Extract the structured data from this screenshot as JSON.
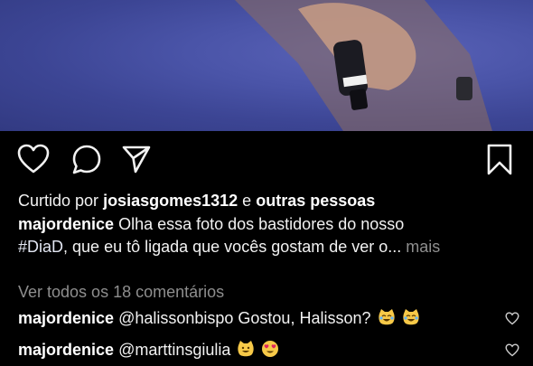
{
  "post": {
    "likes": {
      "prefix": "Curtido por",
      "user": "josiasgomes1312",
      "connector": "e",
      "others": "outras pessoas"
    },
    "caption": {
      "username": "majordenice",
      "text": "Olha essa foto dos bastidores do nosso",
      "hashtag": "#DiaD",
      "text2": ", que eu tô ligada que vocês gostam de ver o...",
      "more_label": "mais"
    },
    "view_comments_label": "Ver todos os 18 comentários",
    "comments": [
      {
        "username": "majordenice",
        "text": "@halissonbispo Gostou, Halisson?",
        "emojis": [
          "joy-cat-emoji",
          "joy-cat-emoji"
        ]
      },
      {
        "username": "majordenice",
        "text": "@marttinsgiulia",
        "emojis": [
          "smiley-cat-emoji",
          "heart-eyes-emoji"
        ]
      }
    ]
  },
  "icons": {
    "like": "heart-icon",
    "comment": "comment-bubble-icon",
    "share": "paper-plane-icon",
    "save": "bookmark-icon"
  },
  "colors": {
    "background": "#000000",
    "text": "#f2f2f2",
    "muted": "#8e8e8e",
    "emoji": "#f7c948"
  }
}
